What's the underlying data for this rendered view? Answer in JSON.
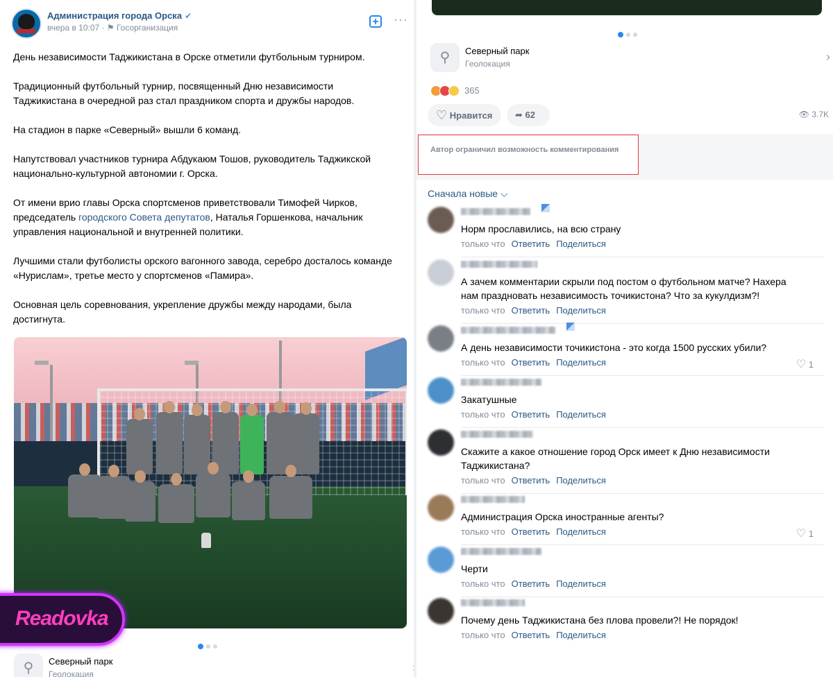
{
  "post": {
    "org_name": "Администрация города Орска",
    "verified_mark": "✔",
    "time": "вчера в 10:07",
    "org_type": "Госорганизация",
    "paragraphs": [
      "День независимости Таджикистана в Орске отметили футбольным турниром.",
      "Традиционный футбольный турнир, посвященный Дню независимости\nТаджикистана в очередной раз стал праздником спорта и дружбы народов.",
      "На стадион в парке «Северный» вышли 6 команд.",
      "Напутствовал участников турнира Абдукаюм Тошов, руководитель Таджикской\nнационально-культурной автономии г. Орска.",
      "Лучшими стали футболисты орского вагонного завода, серебро досталось команде\n«Нурислам», третье место у спортсменов «Памира».",
      "Основная цель соревнования, укрепление дружбы между народами, была\nдостигнута."
    ],
    "p5": {
      "before": "От имени врио главы Орска спортсменов приветствовали Тимофей Чирков,\nпредседатель ",
      "link": "городского Совета депутатов",
      "after": ", Наталья Горшенкова, начальник\nуправления национальной и внутренней политики."
    },
    "geo": {
      "name": "Северный парк",
      "sub": "Геолокация"
    },
    "reactions_count": "365",
    "like_label": "Нравится",
    "share_count": "62",
    "views": "3.7K",
    "comments_restricted": "Автор ограничил возможность комментирования",
    "sort_label": "Сначала новые ⌵"
  },
  "watermark": "Readovka",
  "comment_actions": {
    "time": "только что",
    "reply": "Ответить",
    "share": "Поделиться"
  },
  "comments": [
    {
      "text": "Норм прославились, на всю страну",
      "likes": ""
    },
    {
      "text": "А зачем комментарии скрыли под постом о футбольном матче? Нахера нам праздновать независимость точикистона? Что за кукулдизм?!",
      "likes": ""
    },
    {
      "text": "А день независимости точикистона - это когда 1500 русских убили?",
      "likes": "1"
    },
    {
      "text": "Закатушные",
      "likes": ""
    },
    {
      "text": "Скажите а какое отношение город Орск имеет к Дню независимости Таджикистана?",
      "likes": ""
    },
    {
      "text": "Администрация Орска иностранные агенты?",
      "likes": "1"
    },
    {
      "text": "Черти",
      "likes": ""
    },
    {
      "text": "Почему день Таджикистана без плова провели?! Не порядок!",
      "likes": ""
    }
  ]
}
